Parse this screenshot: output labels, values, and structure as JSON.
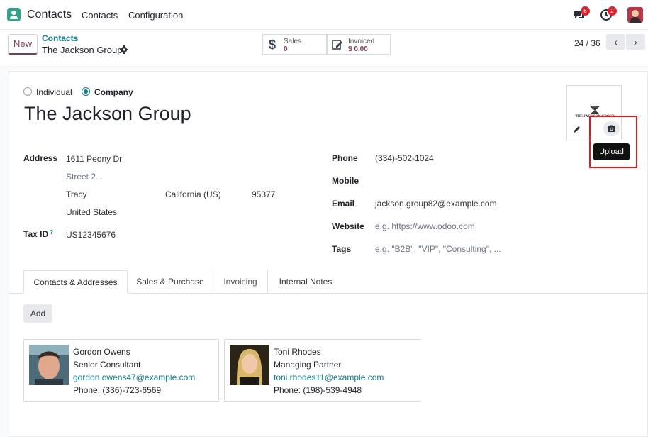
{
  "app": {
    "name": "Contacts",
    "menu": [
      "Contacts",
      "Configuration"
    ],
    "messages_badge": "6",
    "activities_badge": "2"
  },
  "control": {
    "new_label": "New",
    "breadcrumb_parent": "Contacts",
    "breadcrumb_current": "The Jackson Group",
    "stats": [
      {
        "label": "Sales",
        "value": "0",
        "icon": "dollar-icon"
      },
      {
        "label": "Invoiced",
        "value": "$ 0.00",
        "icon": "invoice-edit-icon"
      }
    ],
    "pager": "24 / 36"
  },
  "form": {
    "type_options": [
      "Individual",
      "Company"
    ],
    "selected_type": "Company",
    "name": "The Jackson Group",
    "address_label": "Address",
    "street": "1611 Peony Dr",
    "street2_placeholder": "Street 2...",
    "city": "Tracy",
    "state": "California (US)",
    "zip": "95377",
    "country": "United States",
    "tax_label": "Tax ID",
    "tax_help": "?",
    "tax_id": "US12345676",
    "phone_label": "Phone",
    "phone": "(334)-502-1024",
    "mobile_label": "Mobile",
    "mobile": "",
    "email_label": "Email",
    "email": "jackson.group82@example.com",
    "website_label": "Website",
    "website_placeholder": "e.g. https://www.odoo.com",
    "tags_label": "Tags",
    "tags_placeholder": "e.g. \"B2B\", \"VIP\", \"Consulting\", ...",
    "logo_text": "THE JACKSON GROUP",
    "upload_tooltip": "Upload"
  },
  "tabs": [
    {
      "label": "Contacts & Addresses",
      "active": true
    },
    {
      "label": "Sales & Purchase",
      "active": false
    },
    {
      "label": "Invoicing",
      "active": false
    },
    {
      "label": "Internal Notes",
      "active": false
    }
  ],
  "add_label": "Add",
  "contacts": [
    {
      "name": "Gordon Owens",
      "title": "Senior Consultant",
      "email": "gordon.owens47@example.com",
      "phone": "Phone: (336)-723-6569"
    },
    {
      "name": "Toni Rhodes",
      "title": "Managing Partner",
      "email": "toni.rhodes11@example.com",
      "phone": "Phone: (198)-539-4948"
    }
  ],
  "colors": {
    "brand": "#7c3b5d",
    "teal": "#0f7d87",
    "highlight": "#e11b1b"
  }
}
